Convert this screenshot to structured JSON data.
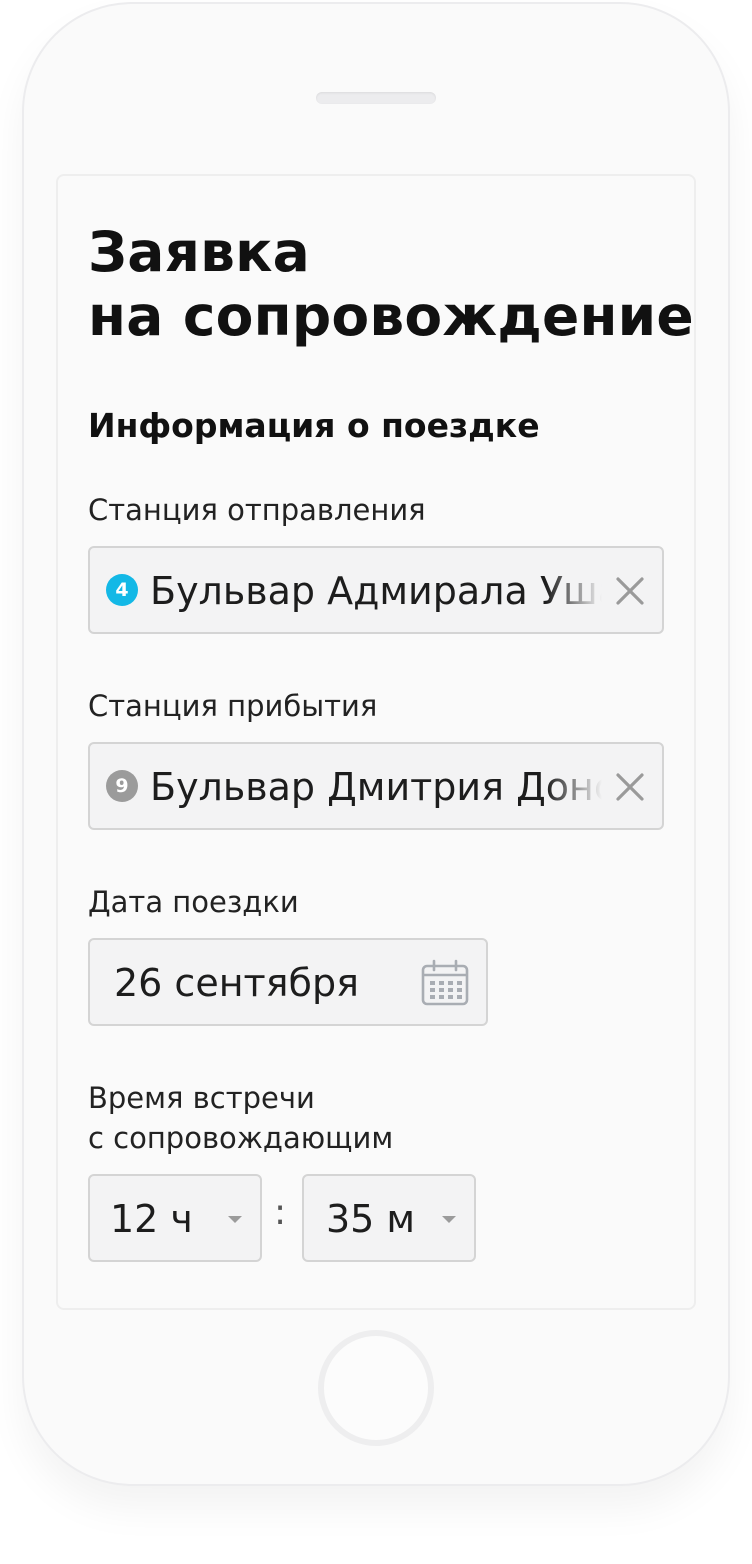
{
  "form": {
    "title_line1": "Заявка",
    "title_line2": "на сопровождение",
    "section_heading": "Информация о поездке"
  },
  "departure": {
    "label": "Станция отправления",
    "line_number": "4",
    "line_color": "#13b8e6",
    "station": "Бульвар Адмирала Ушакова"
  },
  "arrival": {
    "label": "Станция прибытия",
    "line_number": "9",
    "line_color": "#9b9b9b",
    "station": "Бульвар Дмитрия Донского"
  },
  "date": {
    "label": "Дата поездки",
    "value": "26 сентября",
    "icon": "calendar-icon"
  },
  "meeting_time": {
    "label_line1": "Время встречи",
    "label_line2": "с сопровождающим",
    "hours": "12 ч",
    "separator": ":",
    "minutes": "35 м"
  },
  "icons": {
    "clear": "close-icon",
    "dropdown": "chevron-down-icon"
  },
  "colors": {
    "field_background": "#f3f3f4",
    "field_border": "#d4d4d4",
    "text": "#111111"
  }
}
